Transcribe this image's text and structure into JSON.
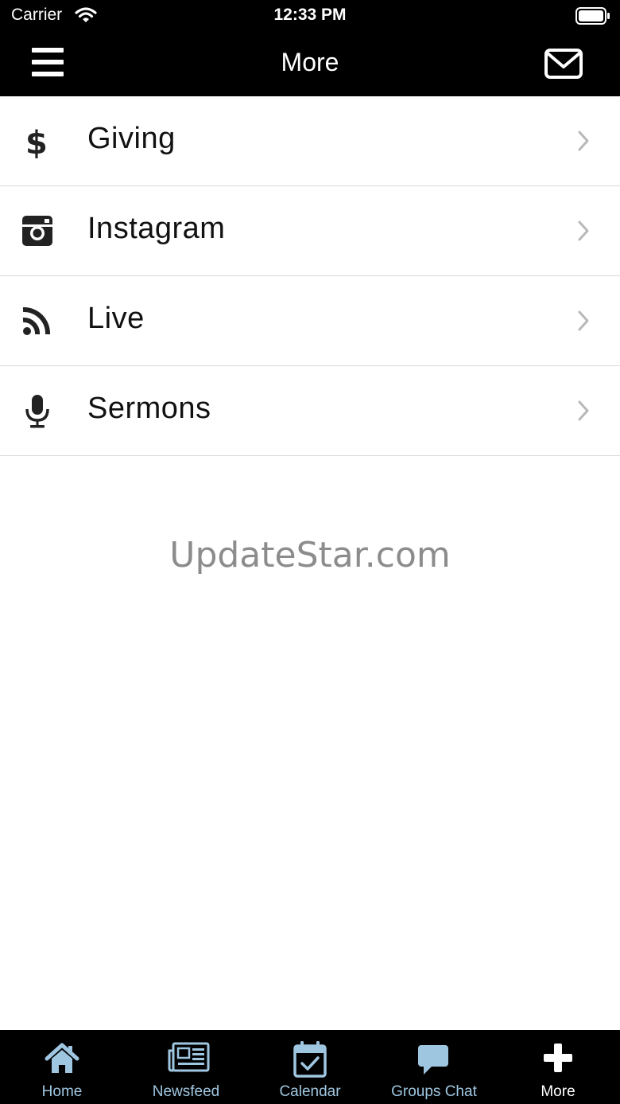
{
  "status_bar": {
    "carrier": "Carrier",
    "time": "12:33 PM"
  },
  "nav": {
    "title": "More",
    "left_icon": "hamburger-menu-icon",
    "right_icon": "mail-icon"
  },
  "menu_items": [
    {
      "label": "Giving",
      "icon": "dollar-icon"
    },
    {
      "label": "Instagram",
      "icon": "instagram-icon"
    },
    {
      "label": "Live",
      "icon": "rss-icon"
    },
    {
      "label": "Sermons",
      "icon": "microphone-icon"
    }
  ],
  "watermark": "UpdateStar.com",
  "tabs": [
    {
      "label": "Home",
      "icon": "home-icon",
      "active": false
    },
    {
      "label": "Newsfeed",
      "icon": "newspaper-icon",
      "active": false
    },
    {
      "label": "Calendar",
      "icon": "calendar-icon",
      "active": false
    },
    {
      "label": "Groups Chat",
      "icon": "chat-bubble-icon",
      "active": false
    },
    {
      "label": "More",
      "icon": "plus-icon",
      "active": true
    }
  ],
  "colors": {
    "bar_background": "#000000",
    "tab_inactive": "#9fc6e0",
    "tab_active": "#ffffff",
    "separator": "#d8d8d8"
  }
}
